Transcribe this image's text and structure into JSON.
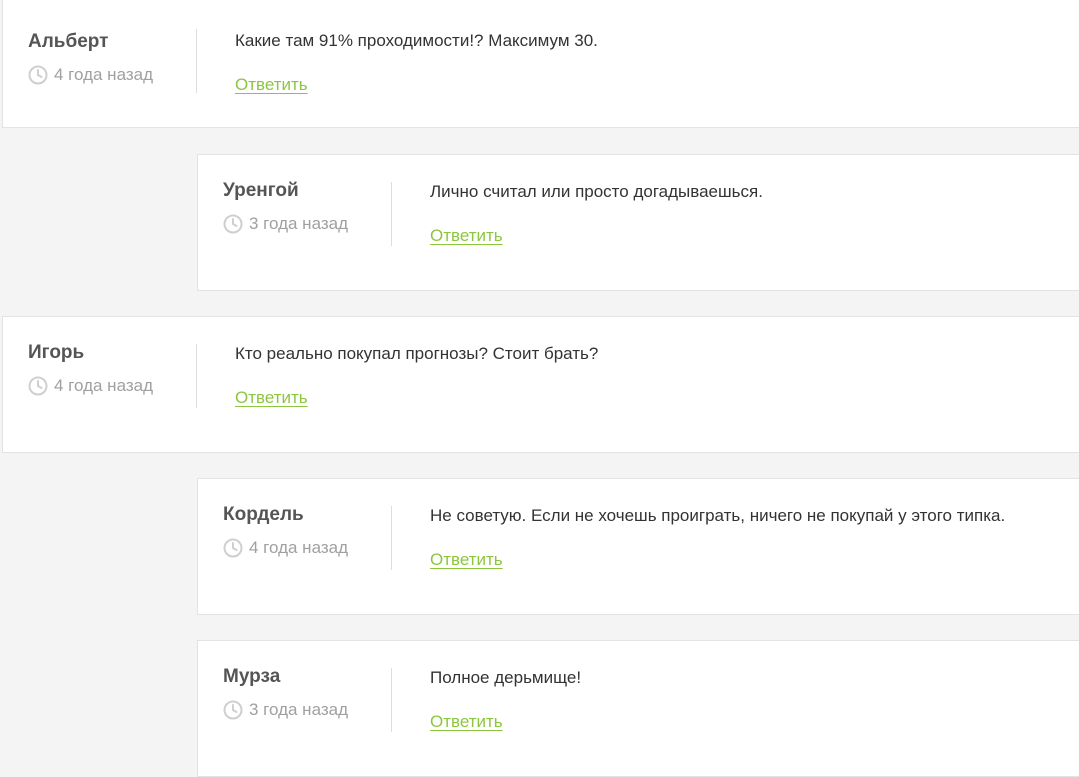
{
  "comments": [
    {
      "author": "Альберт",
      "date": "4 года назад",
      "text": "Какие там 91% проходимости!? Максимум 30.",
      "reply_label": "Ответить",
      "level": 0
    },
    {
      "author": "Уренгой",
      "date": "3 года назад",
      "text": "Лично считал или просто догадываешься.",
      "reply_label": "Ответить",
      "level": 1
    },
    {
      "author": "Игорь",
      "date": "4 года назад",
      "text": "Кто реально покупал прогнозы? Стоит брать?",
      "reply_label": "Ответить",
      "level": 0
    },
    {
      "author": "Кордель",
      "date": "4 года назад",
      "text": "Не советую. Если не хочешь проиграть, ничего не покупай у этого типка.",
      "reply_label": "Ответить",
      "level": 1
    },
    {
      "author": "Мурза",
      "date": "3 года назад",
      "text": "Полное дерьмище!",
      "reply_label": "Ответить",
      "level": 1
    }
  ],
  "icons": {
    "date": "clock-icon"
  },
  "colors": {
    "reply_link": "#8cc63f",
    "author": "#555555",
    "date": "#a0a0a0",
    "background": "#f4f4f4",
    "card": "#ffffff"
  }
}
